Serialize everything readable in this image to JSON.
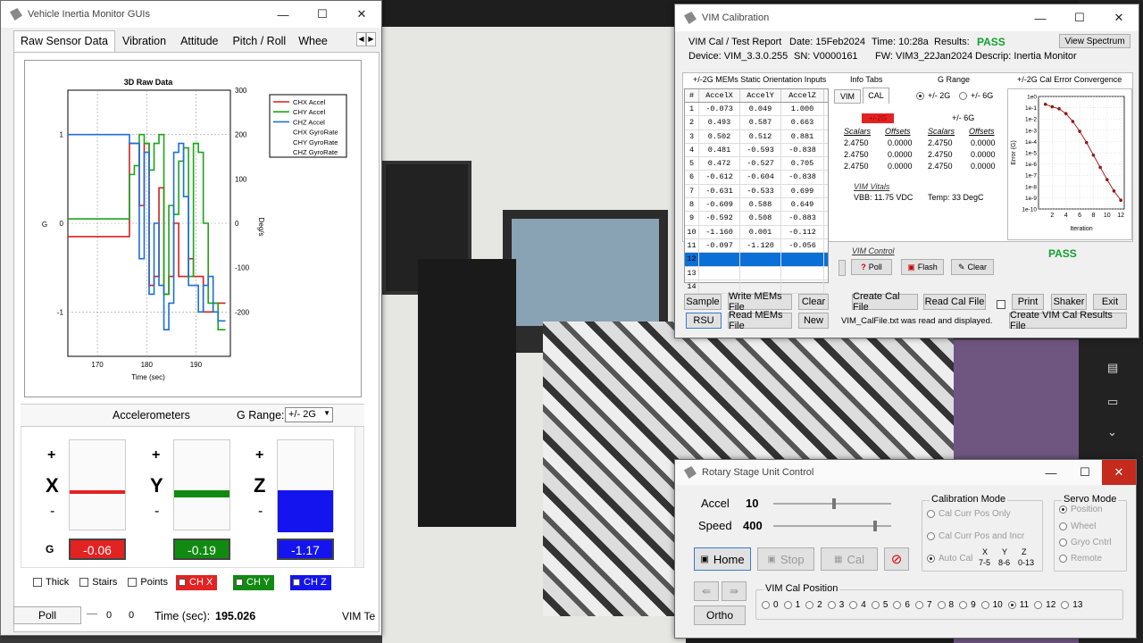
{
  "vim_gui": {
    "title": "Vehicle Inertia Monitor GUIs",
    "tabs": [
      "Raw Sensor Data",
      "Vibration",
      "Attitude",
      "Pitch / Roll",
      "Whee"
    ],
    "chart": {
      "title": "3D Raw Data",
      "xlabel": "Time (sec)",
      "ylabel": "G",
      "y2label": "Deg/s",
      "xticks": [
        "170",
        "180",
        "190"
      ],
      "yticks": [
        "1",
        "0",
        "-1"
      ],
      "y2ticks": [
        "300",
        "200",
        "100",
        "0",
        "-100",
        "-200"
      ],
      "legend": [
        "CHX Accel",
        "CHY Accel",
        "CHZ Accel",
        "CHX GyroRate",
        "CHY GyroRate",
        "CHZ GyroRate"
      ]
    },
    "accel_title": "Accelerometers",
    "grange_label": "G Range:",
    "grange_value": "+/- 2G",
    "plus": "+",
    "minus": "-",
    "axes": [
      {
        "name": "X",
        "value": "-0.06",
        "color": "#e32222",
        "level": -0.06
      },
      {
        "name": "Y",
        "value": "-0.19",
        "color": "#118a11",
        "level": -0.19
      },
      {
        "name": "Z",
        "value": "-1.17",
        "color": "#1414ee",
        "level": -1.17
      }
    ],
    "g_label": "G",
    "opts": [
      "Thick",
      "Stairs",
      "Points"
    ],
    "ch": [
      "CH X",
      "CH Y",
      "CH Z"
    ],
    "poll": "Poll",
    "zero1": "0",
    "zero2": "0",
    "time_label": "Time (sec):",
    "time_value": "195.026",
    "vim_te": "VIM Te"
  },
  "cal": {
    "title": "VIM Calibration",
    "report": "VIM Cal / Test Report",
    "date": "Date: 15Feb2024",
    "time": "Time: 10:28a",
    "results_label": "Results:",
    "results": "PASS",
    "view_spectrum": "View Spectrum",
    "device": "Device: VIM_3.3.0.255",
    "sn": "SN: V0000161",
    "fw": "FW: VIM3_22Jan2024",
    "descrip": "Descrip: Inertia Monitor",
    "static_title": "+/-2G MEMs Static Orientation Inputs",
    "cols": [
      "#",
      "AccelX",
      "AccelY",
      "AccelZ"
    ],
    "rows": [
      [
        "1",
        "-0.073",
        "0.049",
        "1.000"
      ],
      [
        "2",
        "0.493",
        "0.587",
        "0.663"
      ],
      [
        "3",
        "0.502",
        "0.512",
        "0.881"
      ],
      [
        "4",
        "0.481",
        "-0.593",
        "-0.838"
      ],
      [
        "5",
        "0.472",
        "-0.527",
        "0.705"
      ],
      [
        "6",
        "-0.612",
        "-0.604",
        "-0.838"
      ],
      [
        "7",
        "-0.631",
        "-0.533",
        "0.699"
      ],
      [
        "8",
        "-0.609",
        "0.588",
        "0.649"
      ],
      [
        "9",
        "-0.592",
        "0.508",
        "-0.883"
      ],
      [
        "10",
        "-1.160",
        "0.001",
        "-0.112"
      ],
      [
        "11",
        "-0.097",
        "-1.120",
        "-0.056"
      ],
      [
        "12",
        "",
        "",
        ""
      ],
      [
        "13",
        "",
        "",
        ""
      ],
      [
        "14",
        "",
        "",
        ""
      ]
    ],
    "info_tabs": "Info Tabs",
    "tab_vim": "VIM",
    "tab_cal": "CAL",
    "grange": "G Range",
    "r2g": "+/- 2G",
    "r6g": "+/- 6G",
    "badge2g": "+/-2G",
    "lbl6g": "+/- 6G",
    "scalars": "Scalars",
    "offsets": "Offsets",
    "sc2": [
      "2.4750",
      "2.4750",
      "2.4750"
    ],
    "of2": [
      "0.0000",
      "0.0000",
      "0.0000"
    ],
    "sc6": [
      "2.4750",
      "2.4750",
      "2.4750"
    ],
    "of6": [
      "0.0000",
      "0.0000",
      "0.0000"
    ],
    "vitals": "VIM Vitals",
    "vbb": "VBB: 11.75 VDC",
    "temp": "Temp: 33 DegC",
    "control": "VIM Control",
    "poll": "Poll",
    "flash": "Flash",
    "clear_btn": "Clear",
    "conv_title": "+/-2G Cal Error Convergence",
    "conv_ylabel": "Error (G)",
    "conv_xlabel": "Iteration",
    "conv_yticks": [
      "1e0",
      "1e-1",
      "1e-2",
      "1e-3",
      "1e-4",
      "1e-5",
      "1e-6",
      "1e-7",
      "1e-8",
      "1e-9",
      "1e-10"
    ],
    "conv_xticks": [
      "2",
      "4",
      "6",
      "8",
      "10",
      "12"
    ],
    "pass": "PASS",
    "buttons": {
      "sample": "Sample",
      "write": "Write MEMs File",
      "clear": "Clear",
      "create": "Create Cal File",
      "read": "Read Cal File",
      "print": "Print",
      "shaker": "Shaker",
      "exit": "Exit",
      "rsu": "RSU",
      "readmems": "Read MEMs File",
      "new": "New",
      "results": "Create VIM Cal Results File"
    },
    "status": "VIM_CalFile.txt was read and displayed."
  },
  "rsu": {
    "title": "Rotary Stage Unit Control",
    "accel_label": "Accel",
    "accel_value": "10",
    "speed_label": "Speed",
    "speed_value": "400",
    "home": "Home",
    "stop": "Stop",
    "cal": "Cal",
    "ortho": "Ortho",
    "calmode": "Calibration Mode",
    "cm1": "Cal Curr Pos Only",
    "cm2": "Cal Curr Pos and Incr",
    "cm3": "Auto Cal",
    "xyz": [
      "X",
      "Y",
      "Z"
    ],
    "xyzv": [
      "7-5",
      "8-6",
      "0-13"
    ],
    "servo": "Servo Mode",
    "sm": [
      "Position",
      "Wheel",
      "Gryo Cntrl",
      "Remote"
    ],
    "calpos": "VIM Cal Position",
    "positions": [
      "0",
      "1",
      "2",
      "3",
      "4",
      "5",
      "6",
      "7",
      "8",
      "9",
      "10",
      "11",
      "12",
      "13"
    ]
  },
  "chart_data": [
    {
      "type": "line",
      "title": "3D Raw Data",
      "xlabel": "Time (sec)",
      "ylabel": "G",
      "y2label": "Deg/s",
      "xlim": [
        164,
        197
      ],
      "ylim": [
        -1.5,
        1.5
      ],
      "y2lim": [
        -300,
        300
      ],
      "series": [
        {
          "name": "CHX Accel",
          "color": "#d42020",
          "x": [
            164,
            176,
            177,
            178,
            179,
            180,
            181,
            182,
            183,
            184,
            185,
            186,
            187,
            188,
            189,
            190,
            191,
            192,
            193,
            194,
            195,
            196
          ],
          "y": [
            -0.15,
            -0.15,
            0.9,
            0.9,
            0.2,
            0.9,
            -0.7,
            -0.6,
            0.4,
            -0.8,
            -0.6,
            0.0,
            -0.6,
            -0.6,
            -0.4,
            -0.6,
            -0.6,
            -1.0,
            -1.0,
            -0.9,
            -0.9,
            -0.9
          ]
        },
        {
          "name": "CHY Accel",
          "color": "#1aa51a",
          "x": [
            164,
            176,
            177,
            178,
            179,
            180,
            181,
            182,
            183,
            184,
            185,
            186,
            187,
            188,
            189,
            190,
            191,
            192,
            193,
            194,
            195,
            196
          ],
          "y": [
            0.05,
            0.05,
            0.55,
            0.65,
            1.0,
            0.9,
            0.6,
            0.9,
            1.0,
            -0.8,
            0.2,
            0.1,
            0.7,
            0.85,
            -0.6,
            0.9,
            0.8,
            0.0,
            -0.9,
            -0.9,
            -1.2,
            -1.2
          ]
        },
        {
          "name": "CHZ Accel",
          "color": "#1c6fd6",
          "x": [
            164,
            176,
            177,
            178,
            179,
            180,
            181,
            182,
            183,
            184,
            185,
            186,
            187,
            188,
            189,
            190,
            191,
            192,
            193,
            194,
            195,
            196
          ],
          "y": [
            1.0,
            1.0,
            0.9,
            0.9,
            -0.4,
            0.8,
            -0.8,
            0.0,
            -0.7,
            -1.2,
            -0.9,
            0.8,
            0.9,
            0.3,
            -0.7,
            -0.7,
            -1.0,
            -0.7,
            -0.6,
            -1.0,
            -1.1,
            -1.1
          ]
        }
      ]
    },
    {
      "type": "line",
      "title": "+/-2G Cal Error Convergence",
      "xlabel": "Iteration",
      "ylabel": "Error (G)",
      "yscale": "log",
      "xlim": [
        0,
        12.5
      ],
      "ylim": [
        1e-10,
        1
      ],
      "series": [
        {
          "name": "",
          "color": "#b32020",
          "x": [
            1,
            2,
            3,
            4,
            5,
            6,
            7,
            8,
            9,
            10,
            11,
            12
          ],
          "y": [
            0.2,
            0.12,
            0.08,
            0.03,
            0.006,
            0.0008,
            8e-05,
            6e-06,
            5e-07,
            4e-08,
            4e-09,
            6e-10
          ]
        }
      ]
    }
  ]
}
